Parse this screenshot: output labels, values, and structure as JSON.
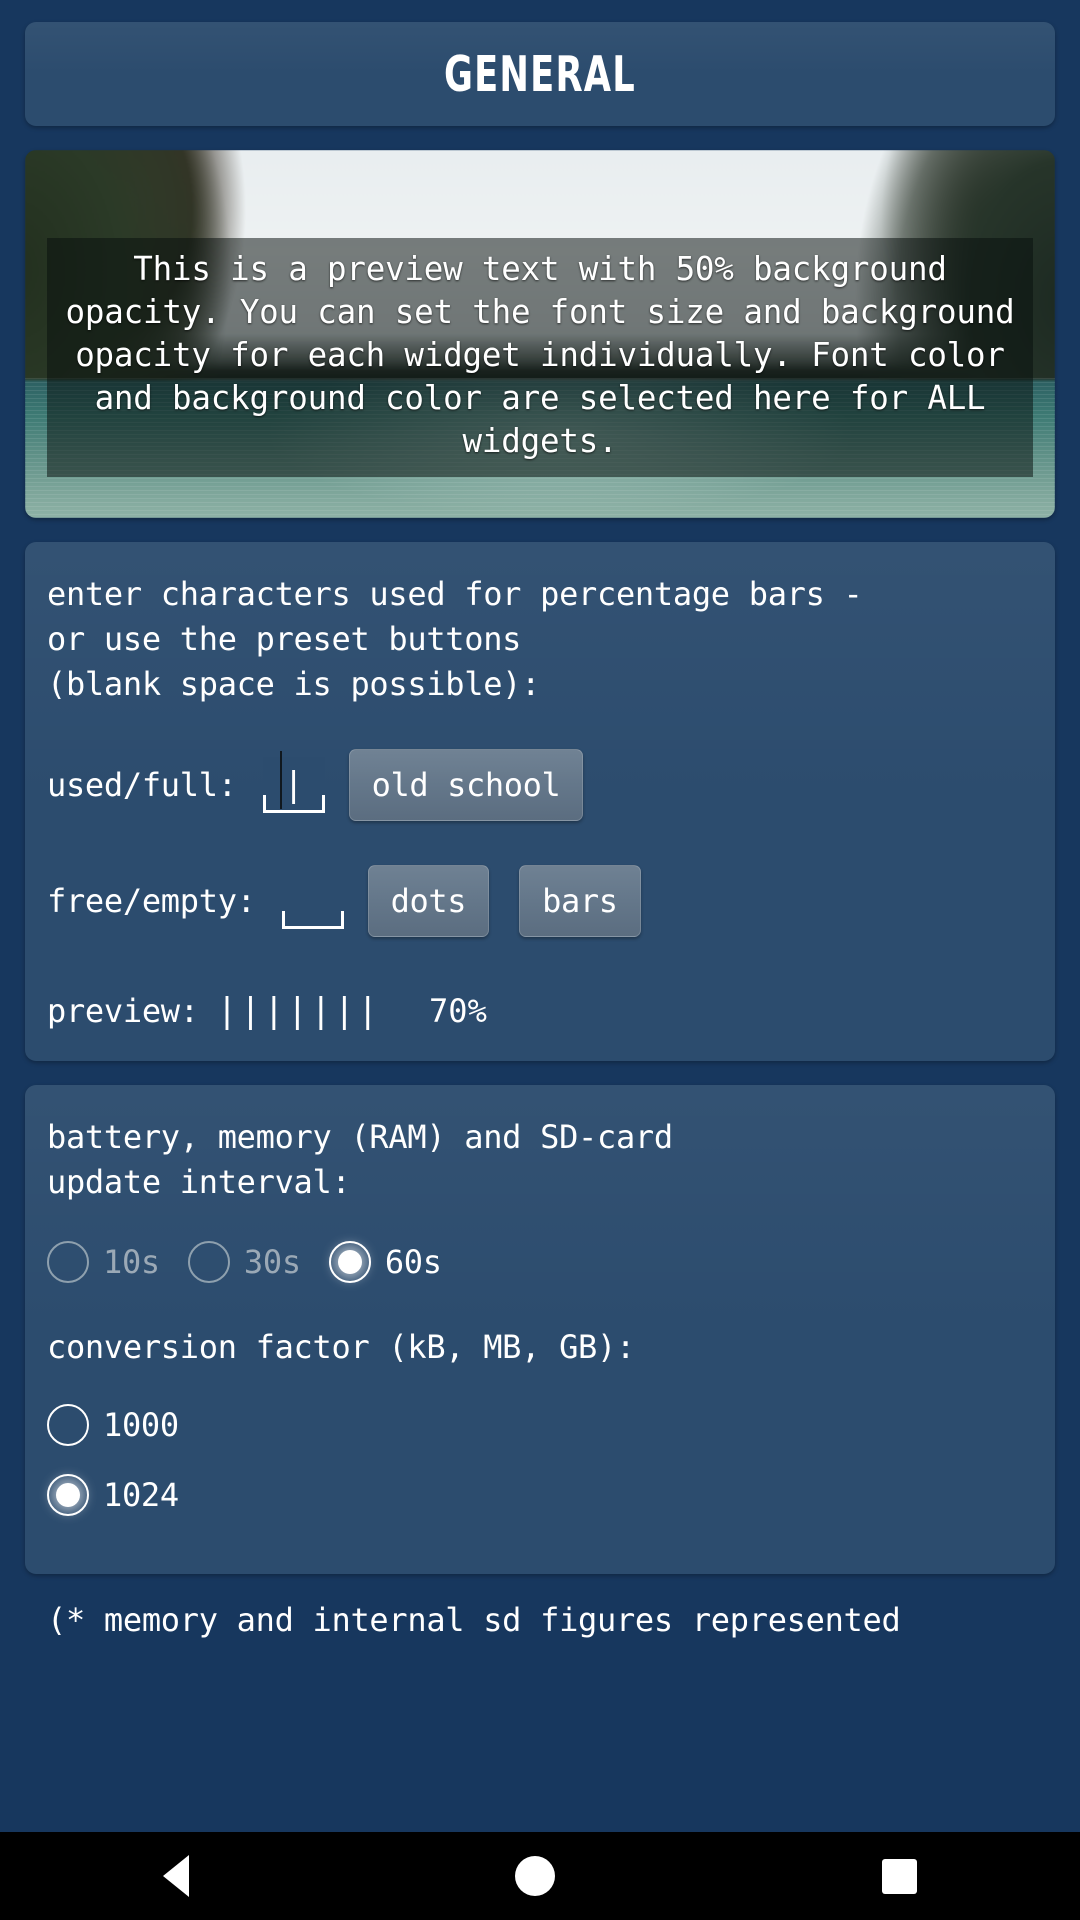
{
  "header": {
    "title": "GENERAL"
  },
  "preview": {
    "text": "This is a preview text with 50% background opacity. You can set the font size and background opacity for each widget individually. Font color and background color are selected here for ALL widgets.",
    "background_opacity_label": "50%"
  },
  "bars_card": {
    "description": "enter characters used for percentage bars -\nor use the preset buttons\n(blank space is possible):",
    "rows": [
      {
        "label": "used/full:",
        "value": "|",
        "placeholder": ""
      },
      {
        "label": "free/empty:",
        "value": "",
        "placeholder": ""
      }
    ],
    "buttons": [
      {
        "label": "old school"
      },
      {
        "label": "dots"
      },
      {
        "label": "bars"
      }
    ],
    "preview": {
      "label": "preview:",
      "glyphs": "|||||||",
      "percent": "70%"
    }
  },
  "update_card": {
    "description": "battery, memory (RAM) and SD-card\nupdate interval:",
    "interval_options": [
      {
        "label": "10s",
        "selected": false,
        "enabled": false
      },
      {
        "label": "30s",
        "selected": false,
        "enabled": false
      },
      {
        "label": "60s",
        "selected": true,
        "enabled": true
      }
    ],
    "conversion_label": "conversion factor (kB, MB, GB):",
    "conversion_options": [
      {
        "label": "1000",
        "selected": false
      },
      {
        "label": "1024",
        "selected": true
      }
    ]
  },
  "footnote": "(* memory and internal sd figures represented",
  "nav": {
    "back": "back-button",
    "home": "home-button",
    "recents": "recents-button"
  },
  "colors": {
    "page_background": "#17375e",
    "card_background": "#2c4c6e",
    "button_background": "#64778a",
    "text": "#ffffff",
    "disabled_text": "#9aa8b5",
    "nav_background": "#000000"
  }
}
